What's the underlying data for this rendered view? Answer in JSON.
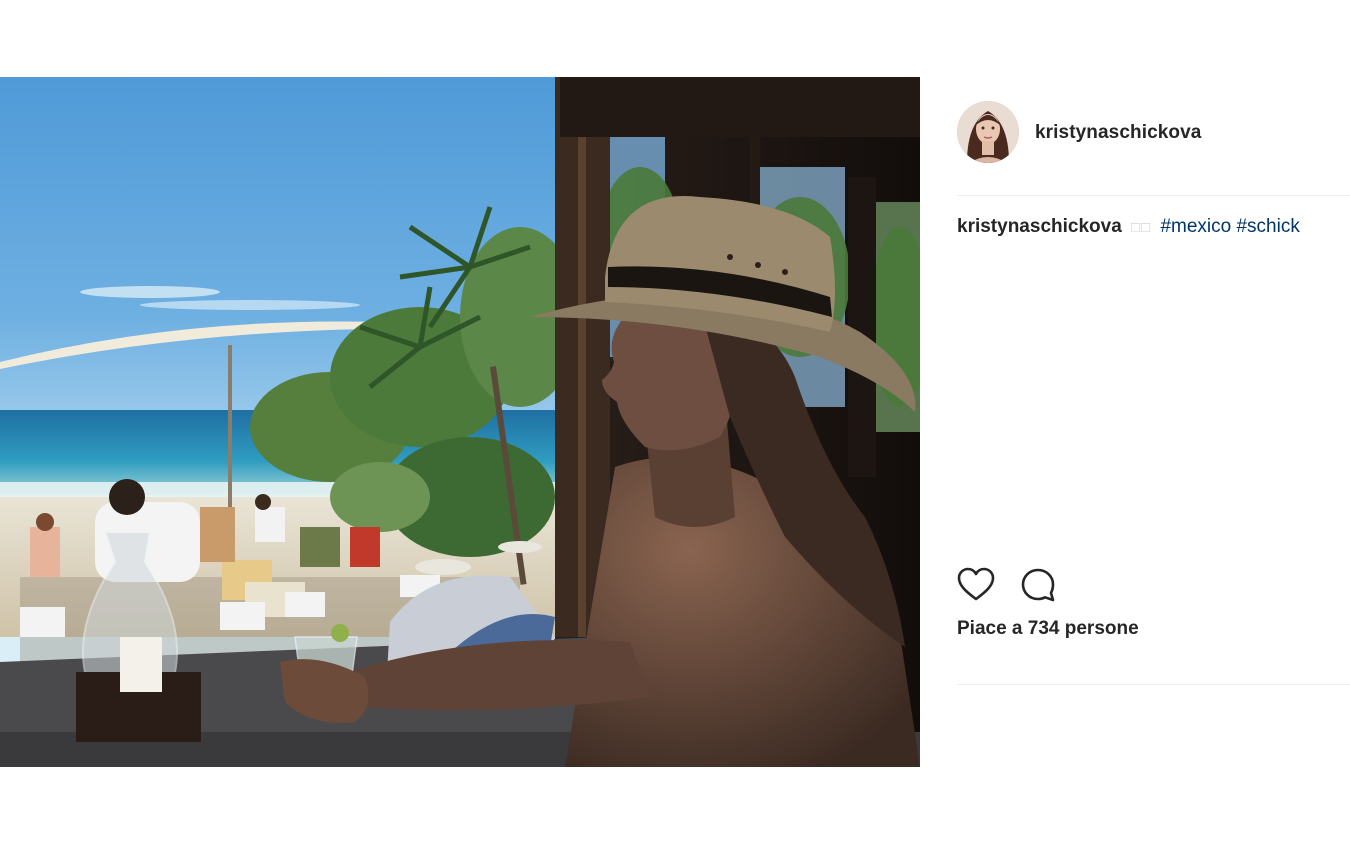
{
  "post": {
    "photo_alt": "",
    "author": {
      "username": "kristynaschickova",
      "avatar_icon": "profile-avatar"
    },
    "caption": {
      "username": "kristynaschickova",
      "emoji": "□□",
      "hashtags": [
        "#mexico",
        "#schick"
      ]
    },
    "actions": {
      "like_icon": "heart-icon",
      "comment_icon": "comment-bubble-icon"
    },
    "likes_text": "Piace a 734 persone"
  },
  "colors": {
    "hashtag": "#003569",
    "text": "#262626",
    "divider": "#efefef"
  }
}
